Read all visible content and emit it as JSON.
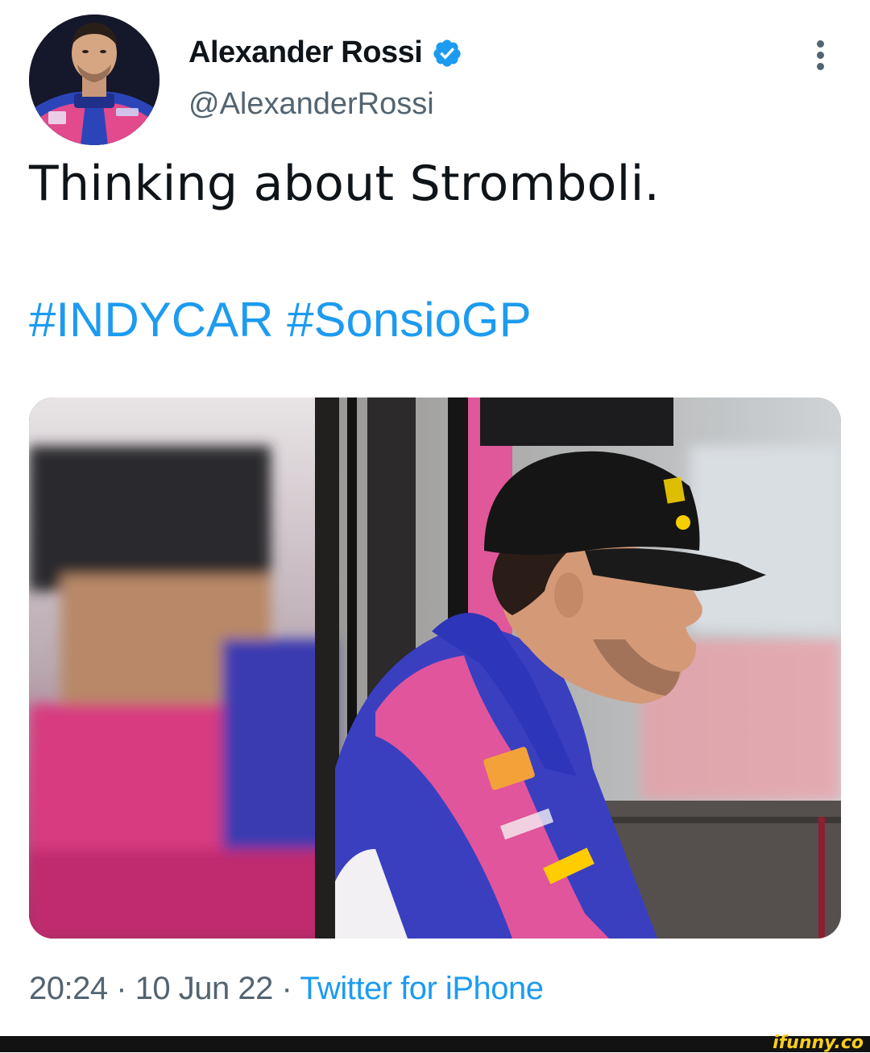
{
  "author": {
    "display_name": "Alexander Rossi",
    "handle": "@AlexanderRossi",
    "verified": true
  },
  "tweet": {
    "text": "Thinking about Stromboli.",
    "hashtags": [
      "#INDYCAR",
      "#SonsioGP"
    ]
  },
  "meta": {
    "time": "20:24",
    "date": "10 Jun 22",
    "separator": "·",
    "source": "Twitter for iPhone"
  },
  "watermark": "ifunny.co",
  "colors": {
    "link": "#1d9bf0",
    "secondary_text": "#536471",
    "primary_text": "#0f1419"
  },
  "icons": {
    "verified": "verified-badge-icon",
    "more": "more-vertical-icon"
  }
}
